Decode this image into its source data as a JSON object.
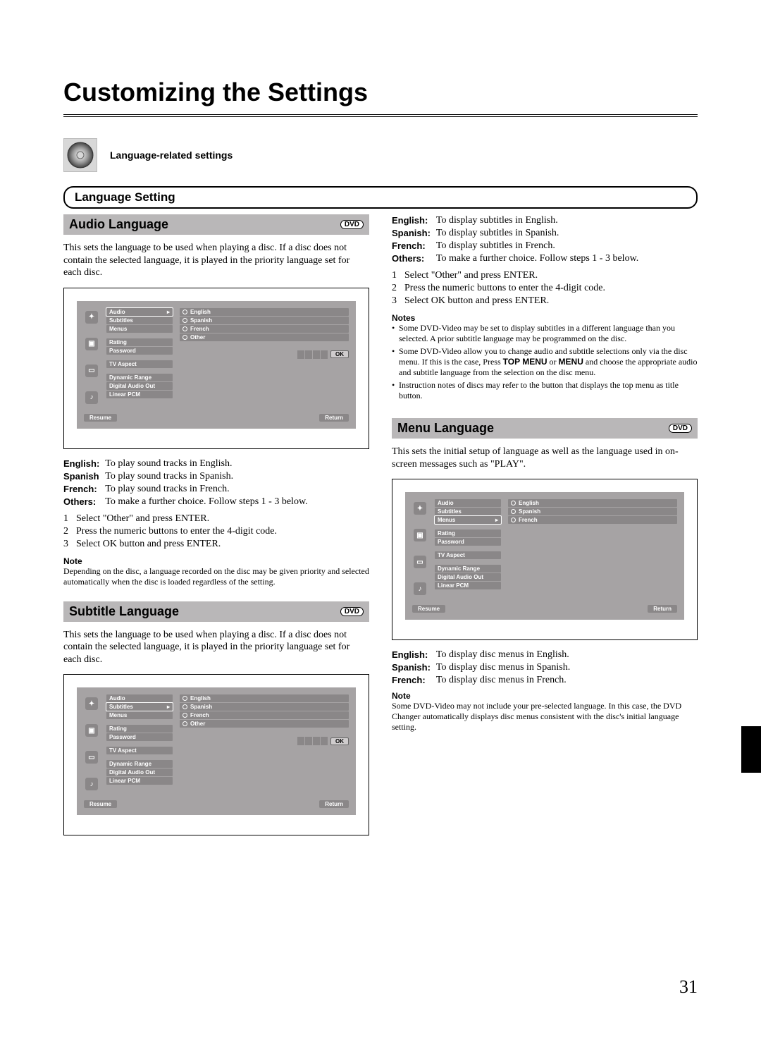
{
  "page": {
    "title": "Customizing the Settings",
    "intro_label": "Language-related settings",
    "tab_header": "Language Setting",
    "page_number": "31"
  },
  "badges": {
    "dvd": "DVD"
  },
  "osd": {
    "menus": [
      [
        "Audio",
        "Subtitles",
        "Menus"
      ],
      [
        "Rating",
        "Password"
      ],
      [
        "TV Aspect"
      ],
      [
        "Dynamic Range",
        "Digital Audio Out",
        "Linear PCM"
      ]
    ],
    "opts4": [
      "English",
      "Spanish",
      "French",
      "Other"
    ],
    "opts3": [
      "English",
      "Spanish",
      "French"
    ],
    "ok": "OK",
    "resume": "Resume",
    "return": "Return"
  },
  "audio": {
    "heading": "Audio Language",
    "desc": "This sets the language to be used when playing a disc. If a disc does not contain the selected language, it is played in the priority language set for each disc.",
    "rows": [
      {
        "label": "English:",
        "text": "To play sound tracks in English."
      },
      {
        "label": "Spanish",
        "text": "To play sound tracks in Spanish."
      },
      {
        "label": "French:",
        "text": "To play sound tracks in French."
      },
      {
        "label": "Others:",
        "text": "To make a further choice. Follow steps 1 - 3 below."
      }
    ],
    "steps": [
      "Select \"Other\" and press ENTER.",
      "Press the numeric buttons to enter the 4-digit code.",
      "Select OK button and press ENTER."
    ],
    "note_head": "Note",
    "note": "Depending on the disc, a language recorded on the disc may be given priority and selected automatically when the disc is loaded regardless of the setting."
  },
  "subtitle": {
    "heading": "Subtitle Language",
    "desc": "This sets the language to be used when playing a disc. If a disc does not contain the selected language, it is played in the priority language set for each disc.",
    "rows": [
      {
        "label": "English:",
        "text": "To display subtitles in English."
      },
      {
        "label": "Spanish:",
        "text": "To display subtitles in Spanish."
      },
      {
        "label": "French:",
        "text": "To display subtitles in French."
      },
      {
        "label": "Others:",
        "text": "To make a further choice. Follow steps 1 - 3 below."
      }
    ],
    "steps": [
      "Select \"Other\" and press ENTER.",
      "Press the numeric buttons to enter the 4-digit code.",
      "Select OK button and press ENTER."
    ],
    "notes_head": "Notes",
    "notes": [
      "Some DVD-Video may be set to display subtitles in a different language than you selected. A prior subtitle language may be programmed on the disc.",
      "Some DVD-Video allow you to change audio and subtitle selections only via the disc menu. If this is the case, Press TOP MENU or MENU and choose the appropriate audio and subtitle language from the selection on the disc menu.",
      "Instruction notes of discs may refer to the button that displays the top menu as title button."
    ]
  },
  "menu": {
    "heading": "Menu Language",
    "desc": "This sets the initial setup of language as well as the language used in on-screen messages such as \"PLAY\".",
    "rows": [
      {
        "label": "English:",
        "text": "To display disc menus in English."
      },
      {
        "label": "Spanish:",
        "text": "To display disc menus in Spanish."
      },
      {
        "label": "French:",
        "text": "To display disc menus in French."
      }
    ],
    "note_head": "Note",
    "note": "Some DVD-Video may not include your pre-selected language. In this case, the DVD Changer automatically displays disc menus consistent with the disc's initial language setting."
  }
}
